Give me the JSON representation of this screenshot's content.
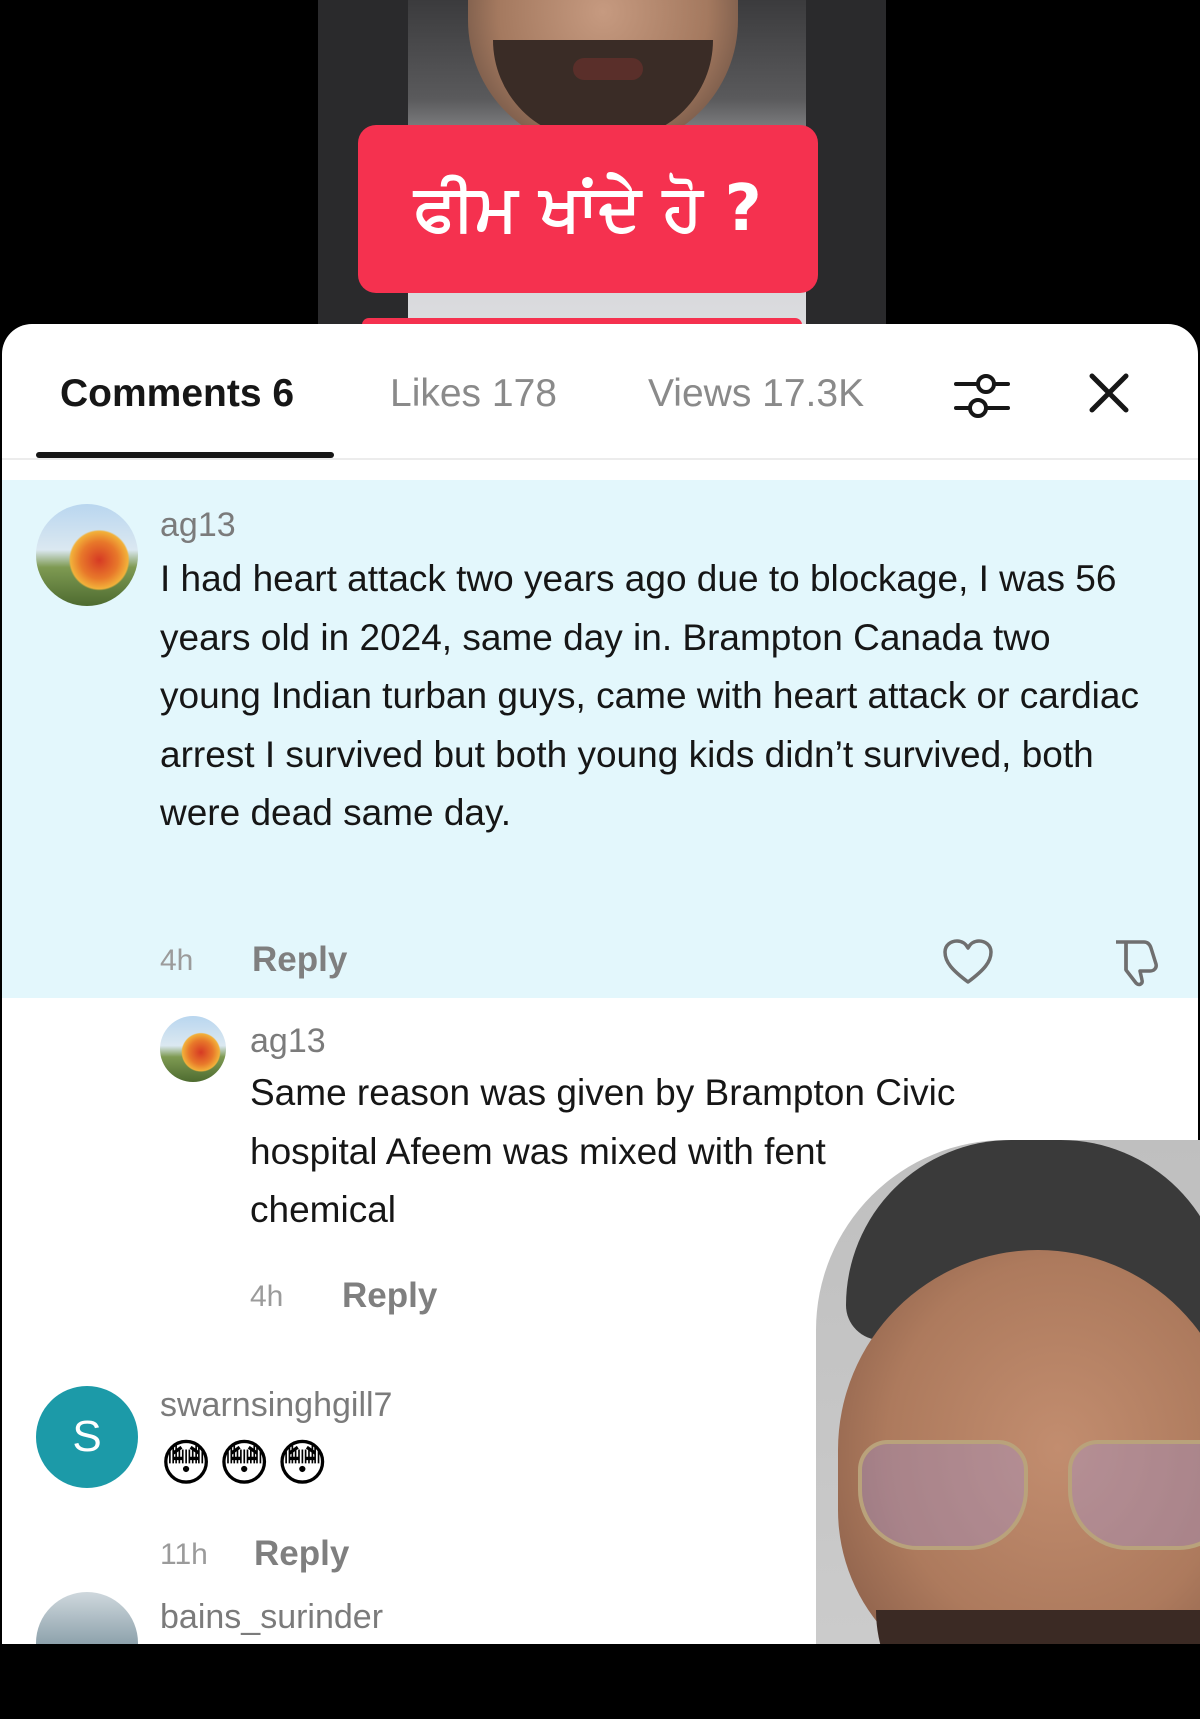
{
  "video": {
    "caption": "ਫੀਮ ਖਾਂਦੇ ਹੋ ?"
  },
  "tabs": {
    "comments": "Comments 6",
    "likes": "Likes 178",
    "views": "Views 17.3K"
  },
  "icons": {
    "filter": "sliders-icon",
    "close": "close-icon",
    "like": "heart-icon",
    "dislike": "thumbs-down-icon"
  },
  "colors": {
    "caption_bg": "#f5314f",
    "highlight_bg": "#e3f7fc",
    "avatar_s_bg": "#1c9aa8"
  },
  "comments": [
    {
      "username": "ag13",
      "text": "I had heart attack two years ago due to blockage, I was 56 years old in 2024, same day in. Brampton Canada two young Indian turban guys, came with heart attack or cardiac arrest I survived but both young kids didn’t survived, both were dead same day.",
      "time": "4h",
      "reply": "Reply"
    },
    {
      "username": "ag13",
      "text": "Same reason was given by Brampton Civic hospital Afeem was mixed with fent",
      "text_end": "chemical",
      "time": "4h",
      "reply": "Reply"
    },
    {
      "username": "swarnsinghgill7",
      "avatar_letter": "S",
      "text": "😳😳😳",
      "time": "11h",
      "reply": "Reply"
    },
    {
      "username": "bains_surinder"
    }
  ]
}
